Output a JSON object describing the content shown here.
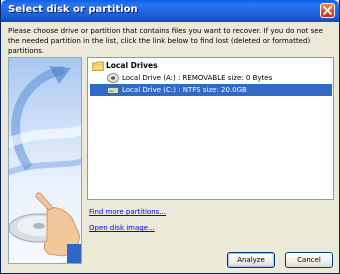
{
  "window": {
    "title": "Select disk or partition"
  },
  "instructions": "Please choose drive or partition that contains files you want to recover. If you do not see the needed partition in the list, click the link below to find lost (deleted or formatted) partitions.",
  "tree": {
    "root_label": "Local Drives",
    "items": [
      {
        "label": "Local Drive (A:) : REMOVABLE size: 0 Bytes",
        "selected": false
      },
      {
        "label": "Local Drive (C:) : NTFS size: 20.0GB",
        "selected": true
      }
    ]
  },
  "links": {
    "find_more": "Find more partitions...",
    "open_image": "Open disk image..."
  },
  "buttons": {
    "analyze": "Analyze",
    "cancel": "Cancel"
  },
  "colors": {
    "title_bar": "#1d5fd6",
    "selection": "#316ac5",
    "link": "#0000ff",
    "close_button": "#d4502a"
  },
  "icons": {
    "close": "close-icon",
    "root": "folder-icon",
    "drive_a": "floppy-drive-icon",
    "drive_c": "hard-drive-icon"
  }
}
